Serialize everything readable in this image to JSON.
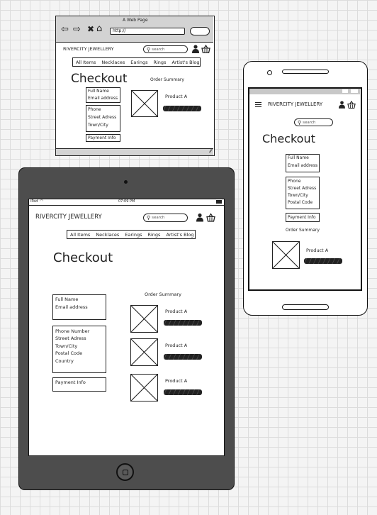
{
  "brand": "RIVERCITY JEWELLERY",
  "browser": {
    "title": "A Web Page",
    "url": "http://"
  },
  "search_placeholder": "search",
  "nav": [
    "All Items",
    "Necklaces",
    "Earings",
    "Rings",
    "Artist's Blog"
  ],
  "checkout_title": "Checkout",
  "order_summary": "Order Summary",
  "product_name": "Product A",
  "desktop_form": {
    "group1": [
      "Full Name",
      "Email address"
    ],
    "group2": [
      "Phone",
      "Street Adress",
      "Town/City"
    ],
    "payment": "Payment Info"
  },
  "tablet": {
    "status_left": "iPad",
    "status_time": "07:09 PM",
    "form": {
      "group1": [
        "Full Name",
        "Email address"
      ],
      "group2": [
        "Phone Number",
        "Street Adress",
        "Town/City",
        "Postal Code",
        "Country"
      ],
      "payment": "Payment Info"
    }
  },
  "phone": {
    "form": {
      "group1": [
        "Full Name",
        "Email address"
      ],
      "group2": [
        "Phone",
        "Street Adress",
        "Town/City",
        "Postal Code"
      ],
      "payment": "Payment Info"
    }
  }
}
